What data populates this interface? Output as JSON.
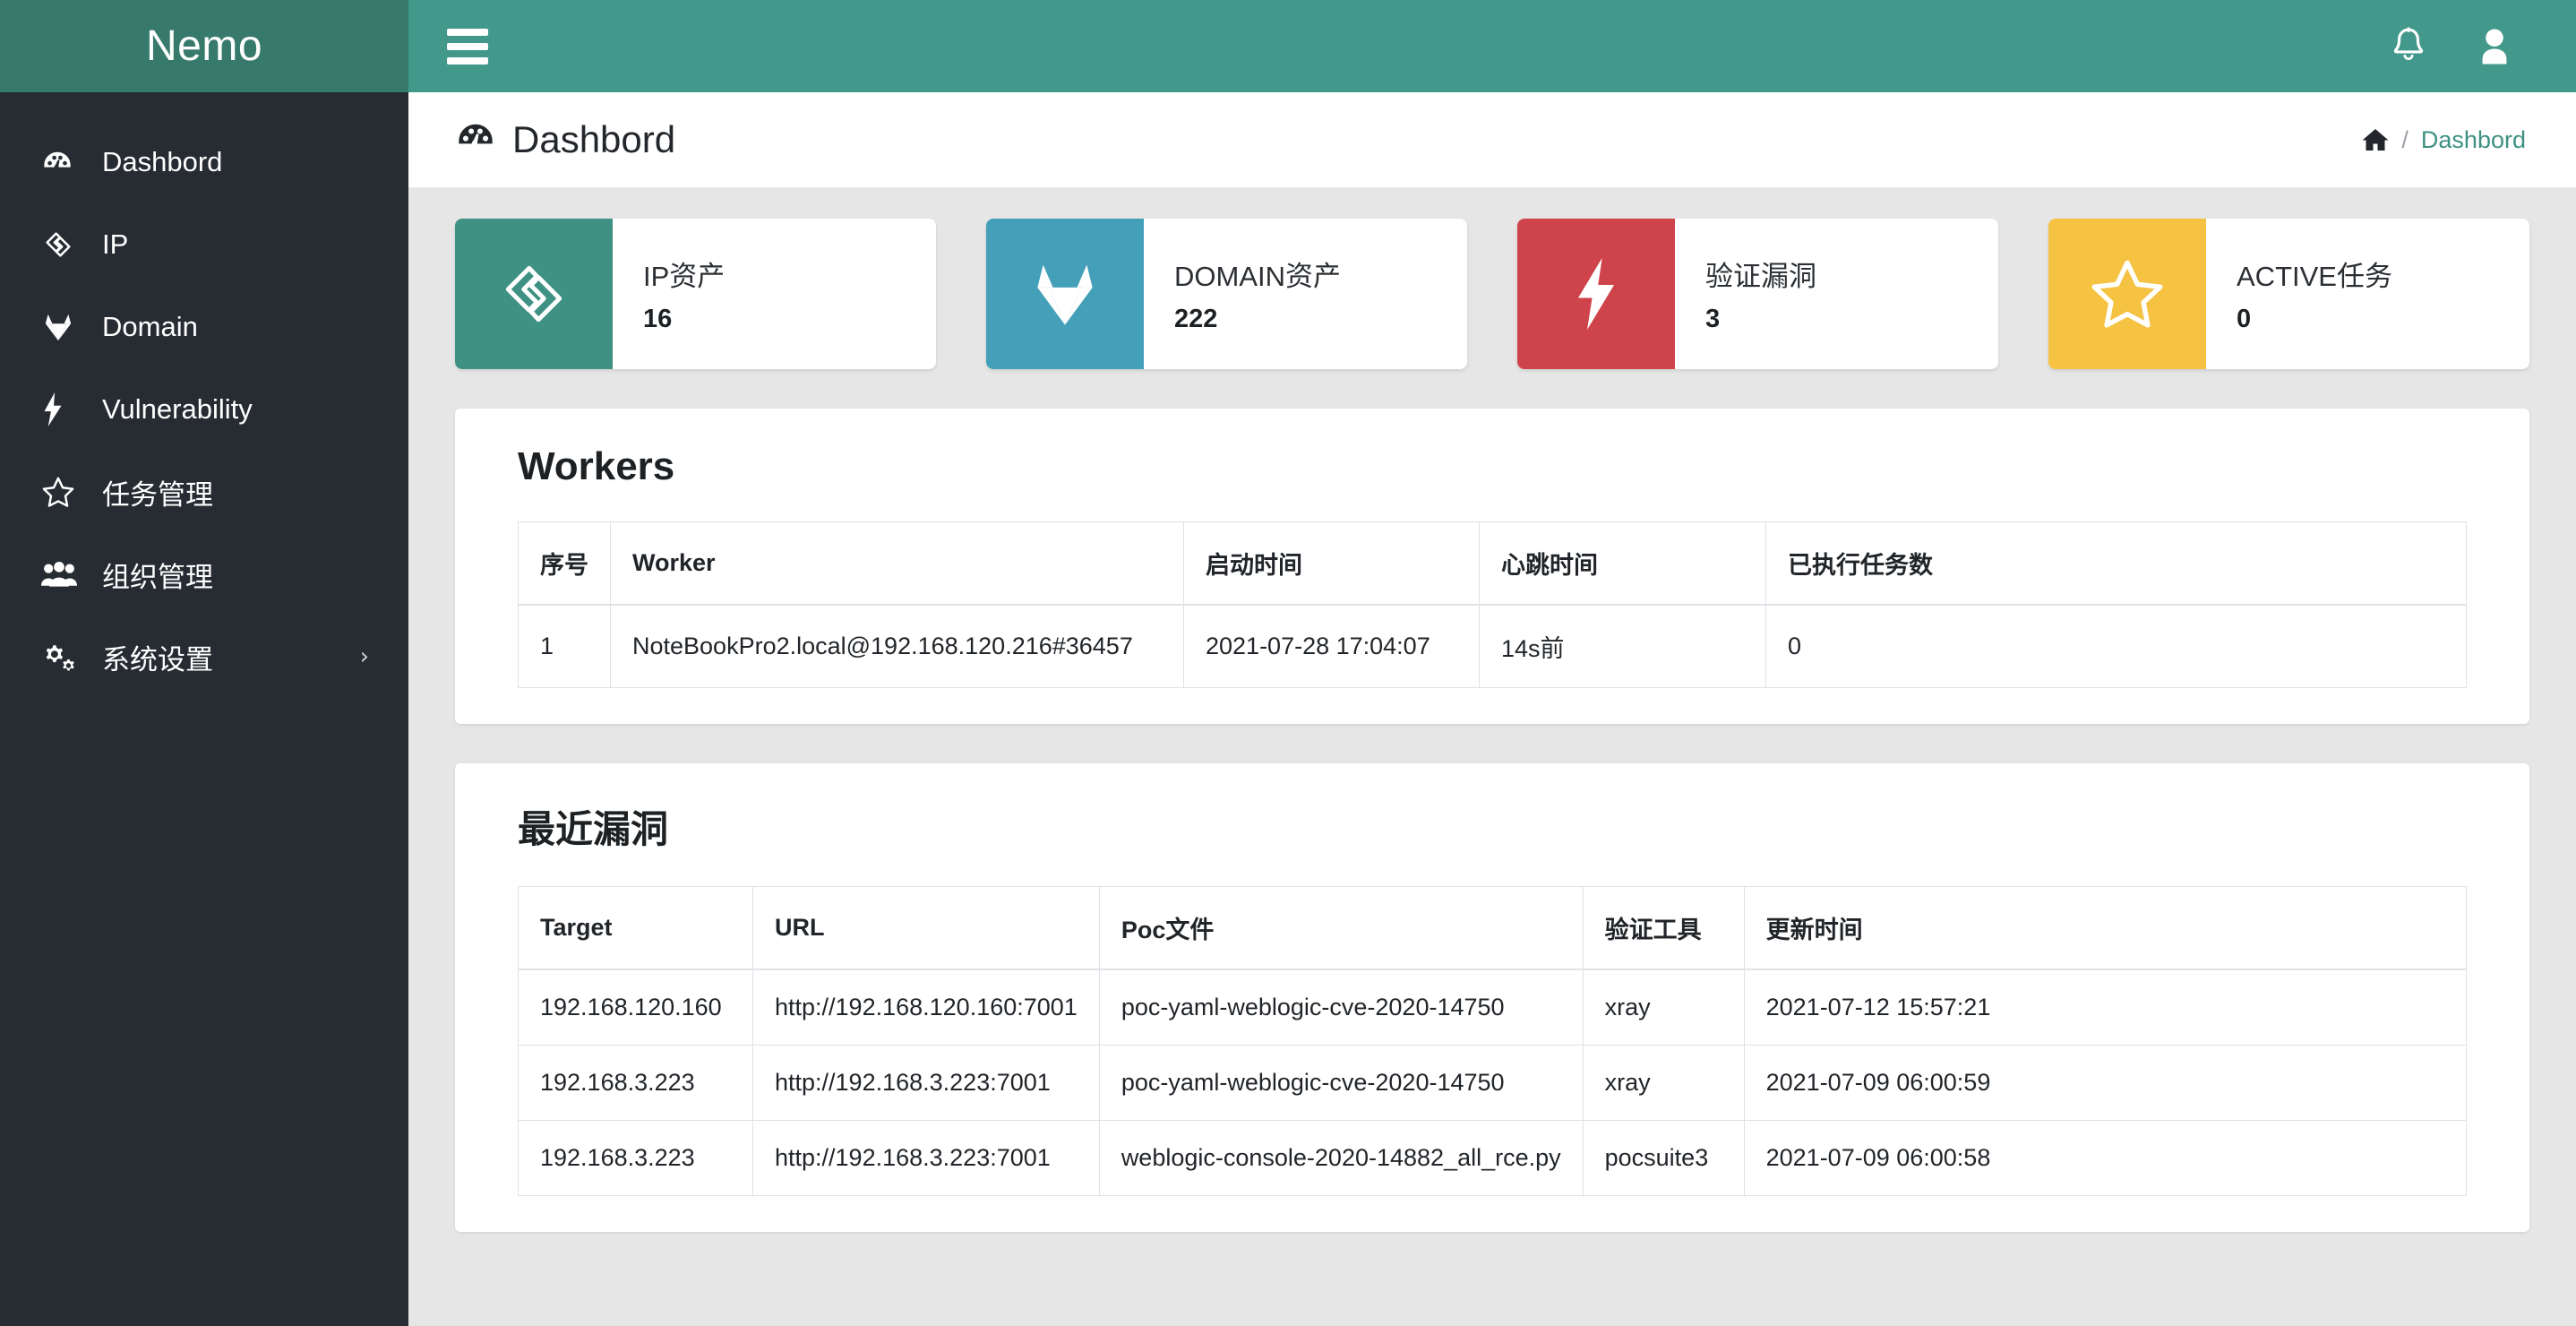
{
  "brand": {
    "name": "Nemo"
  },
  "sidebar": {
    "items": [
      {
        "label": "Dashbord",
        "icon": "tachometer-icon",
        "name": "dashboard",
        "caret": ""
      },
      {
        "label": "IP",
        "icon": "ip-diamond-icon",
        "name": "ip",
        "caret": ""
      },
      {
        "label": "Domain",
        "icon": "fox-icon",
        "name": "domain",
        "caret": ""
      },
      {
        "label": "Vulnerability",
        "icon": "bolt-icon",
        "name": "vulnerability",
        "caret": ""
      },
      {
        "label": "任务管理",
        "icon": "star-icon",
        "name": "task-management",
        "caret": ""
      },
      {
        "label": "组织管理",
        "icon": "users-icon",
        "name": "org-management",
        "caret": ""
      },
      {
        "label": "系统设置",
        "icon": "gears-icon",
        "name": "system-settings",
        "caret": "›"
      }
    ]
  },
  "topbar": {
    "menu_toggle": "hamburger-icon",
    "bell": "bell-icon",
    "user": "user-icon"
  },
  "pagehead": {
    "icon": "tachometer-icon",
    "title": "Dashbord",
    "breadcrumb": {
      "home_icon": "home-icon",
      "separator": "/",
      "current": "Dashbord"
    }
  },
  "stats": [
    {
      "label": "IP资产",
      "value": "16",
      "color": "#3e9183",
      "icon": "ip-diamond-icon"
    },
    {
      "label": "DOMAIN资产",
      "value": "222",
      "color": "#44a0b8",
      "icon": "fox-icon"
    },
    {
      "label": "验证漏洞",
      "value": "3",
      "color": "#cf444b",
      "icon": "bolt-icon"
    },
    {
      "label": "ACTIVE任务",
      "value": "0",
      "color": "#f5c242",
      "icon": "star-icon"
    }
  ],
  "workers": {
    "title": "Workers",
    "columns": [
      "序号",
      "Worker",
      "启动时间",
      "心跳时间",
      "已执行任务数"
    ],
    "rows": [
      {
        "seq": "1",
        "worker": "NoteBookPro2.local@192.168.120.216#36457",
        "start_time": "2021-07-28 17:04:07",
        "heartbeat": "14s前",
        "executed": "0"
      }
    ]
  },
  "recent_vuln": {
    "title": "最近漏洞",
    "columns": [
      "Target",
      "URL",
      "Poc文件",
      "验证工具",
      "更新时间"
    ],
    "rows": [
      {
        "target": "192.168.120.160",
        "url": "http://192.168.120.160:7001",
        "poc": "poc-yaml-weblogic-cve-2020-14750",
        "tool": "xray",
        "updated": "2021-07-12 15:57:21"
      },
      {
        "target": "192.168.3.223",
        "url": "http://192.168.3.223:7001",
        "poc": "poc-yaml-weblogic-cve-2020-14750",
        "tool": "xray",
        "updated": "2021-07-09 06:00:59"
      },
      {
        "target": "192.168.3.223",
        "url": "http://192.168.3.223:7001",
        "poc": "weblogic-console-2020-14882_all_rce.py",
        "tool": "pocsuite3",
        "updated": "2021-07-09 06:00:58"
      }
    ]
  },
  "colors": {
    "brand_teal_dark": "#377a6c",
    "navbar_teal": "#42988a",
    "sidebar_dark": "#272c33",
    "content_bg": "#e6e6e6",
    "accent": "#3e9183"
  }
}
